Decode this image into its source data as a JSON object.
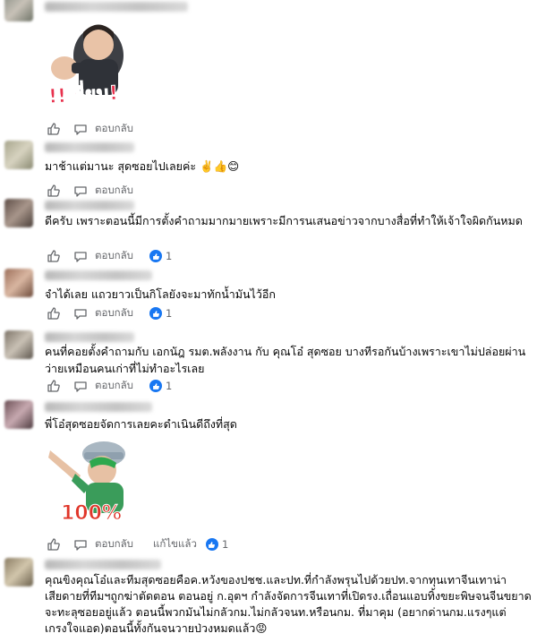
{
  "comments": [
    {
      "reply_label": "ตอบกลับ",
      "sticker_text": "!!เยี่ยม!"
    },
    {
      "text": "มาช้าแต่มานะ สุดซอยไปเลยค่ะ ✌️👍😊",
      "reply_label": "ตอบกลับ"
    },
    {
      "text": "ดีครับ เพราะตอนนี้มีการตั้งคำถามมากมายเพราะมีการนเสนอข่าวจากบางสื่อที่ทำให้เจ้าใจผิดกันหมด",
      "reply_label": "ตอบกลับ",
      "reactions": "1"
    },
    {
      "text": "จำได้เลย แถวยาวเป็นกิโลยังจะมาทักน้ำมันไว้อีก",
      "reply_label": "ตอบกลับ",
      "reactions": "1"
    },
    {
      "text": "คนที่คอยตั้งคำถามกับ เอกนัฎ รมต.พลังงาน กับ คุณโอ๋ สุดซอย บางทีรอกันบ้างเพราะเขาไม่ปล่อยผ่านว่ายเหมือนคนเก่าที่ไม่ทำอะไรเลย",
      "reply_label": "ตอบกลับ",
      "reactions": "1"
    },
    {
      "text": "พี่โอ๋สุดซอยจัดการเลยคะดำเนินดีถึงที่สุด",
      "sticker_text": "100%",
      "reply_label": "ตอบกลับ",
      "edited_label": "แก้ไขแล้ว",
      "reactions": "1"
    },
    {
      "text": "คุณขิงคุณโอ๋และทีมสุดซอยคือค.หวังของปชช.และปท.ที่กำลังพรุนไปด้วยปท.จากทุนเทาจีนเทาน่าเสียดายที่ทีมฯถูกฆ่าตัดตอน ตอนอยู่ ก.อุตฯ กำลังจัดการจีนเทาที่เปิดรง.เถื่อนแอบทิ้งขยะพิษจนจีนขยาดจะทะลุซอยอยู่แล้ว ตอนนี้พวกมันไม่กลัวกม.ไม่กลัวจนท.หรือนกม. ที่มาคุม (อยากด่านกม.แรงๆแต่เกรงใจแอด)ตอนนี้ทั้งกันจนวายป่วงหมดแล้ว😡"
    }
  ],
  "colors": {
    "text": "#050505",
    "secondary": "#65676b",
    "reaction_blue": "#1877f2"
  }
}
